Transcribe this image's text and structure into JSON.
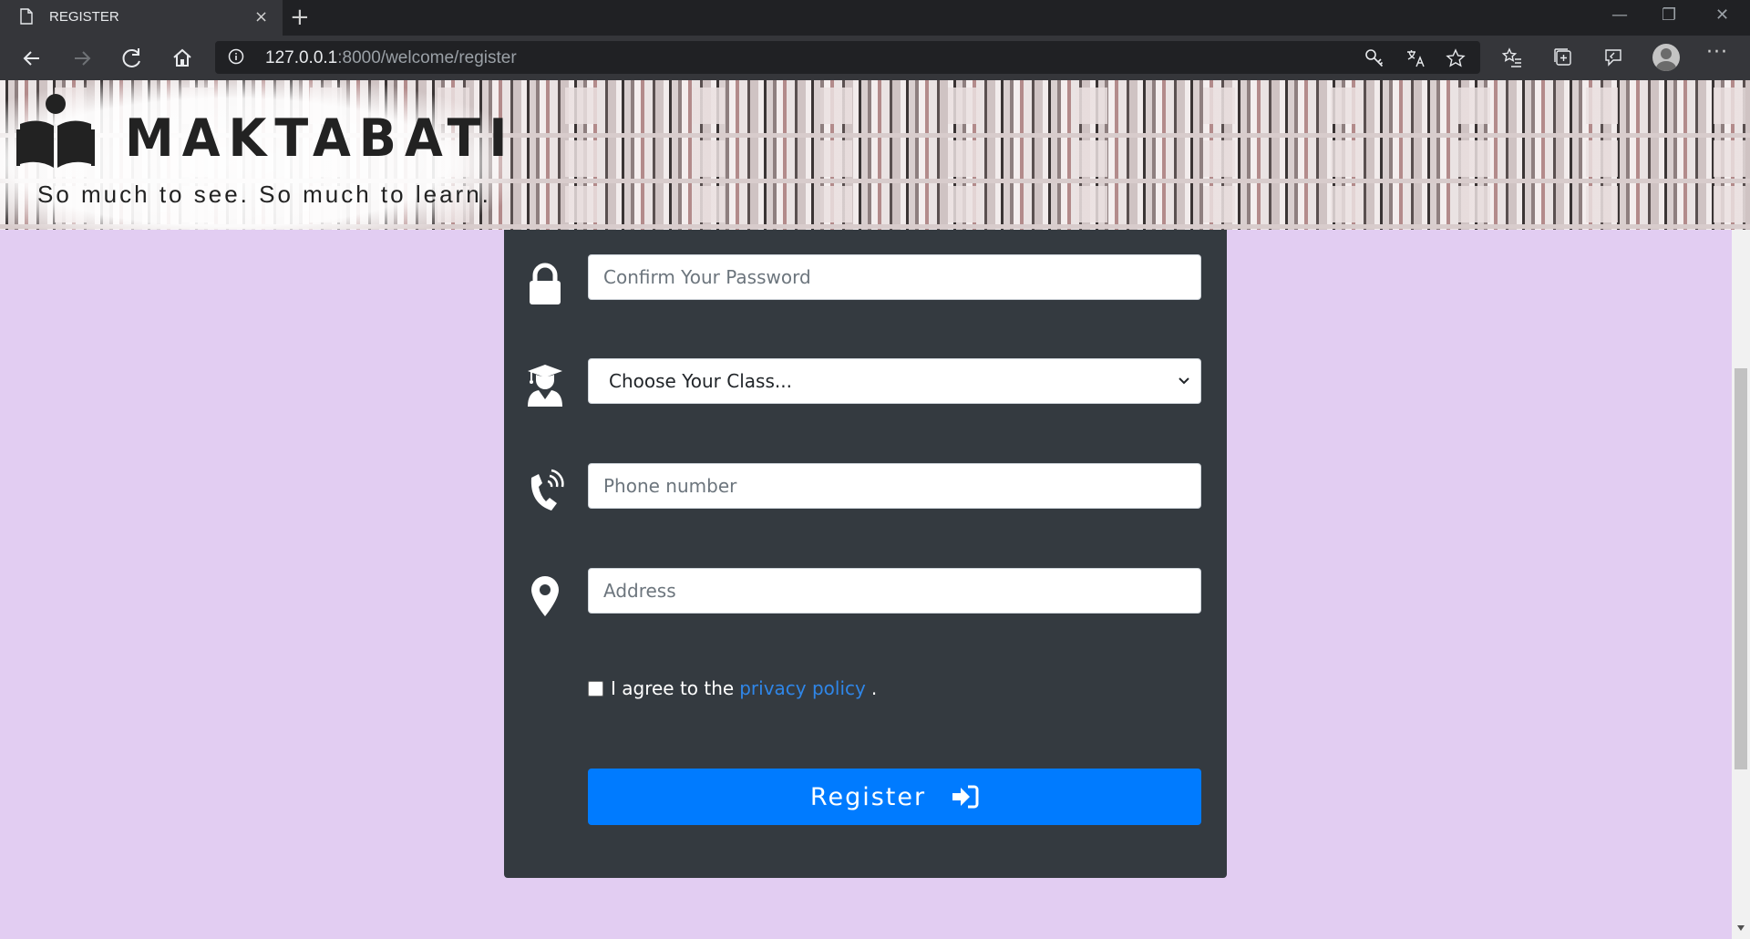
{
  "browser": {
    "tab_title": "REGISTER",
    "tab_close": "×",
    "new_tab": "+",
    "url_host": "127.0.0.1",
    "url_path": ":8000/welcome/register",
    "window_controls": [
      "—",
      "❐",
      "✕"
    ],
    "menu": "···"
  },
  "banner": {
    "brand_name": "MAKTABATI",
    "tagline": "So much to see. So much to learn."
  },
  "form": {
    "confirm_password_placeholder": "Confirm Your Password",
    "class_select_value": "Choose Your Class...",
    "phone_placeholder": "Phone number",
    "address_placeholder": "Address",
    "agree_prefix": "I agree to the",
    "privacy_link": "privacy policy",
    "agree_suffix": ".",
    "register_label": "Register",
    "agree_checked": false
  },
  "colors": {
    "page_bg": "#e2cdf2",
    "card_bg": "#343a40",
    "button_bg": "#007bff",
    "link": "#2f86e8"
  },
  "icons": [
    "lock-icon",
    "graduate-icon",
    "phone-icon",
    "map-marker-icon",
    "sign-in-icon"
  ]
}
